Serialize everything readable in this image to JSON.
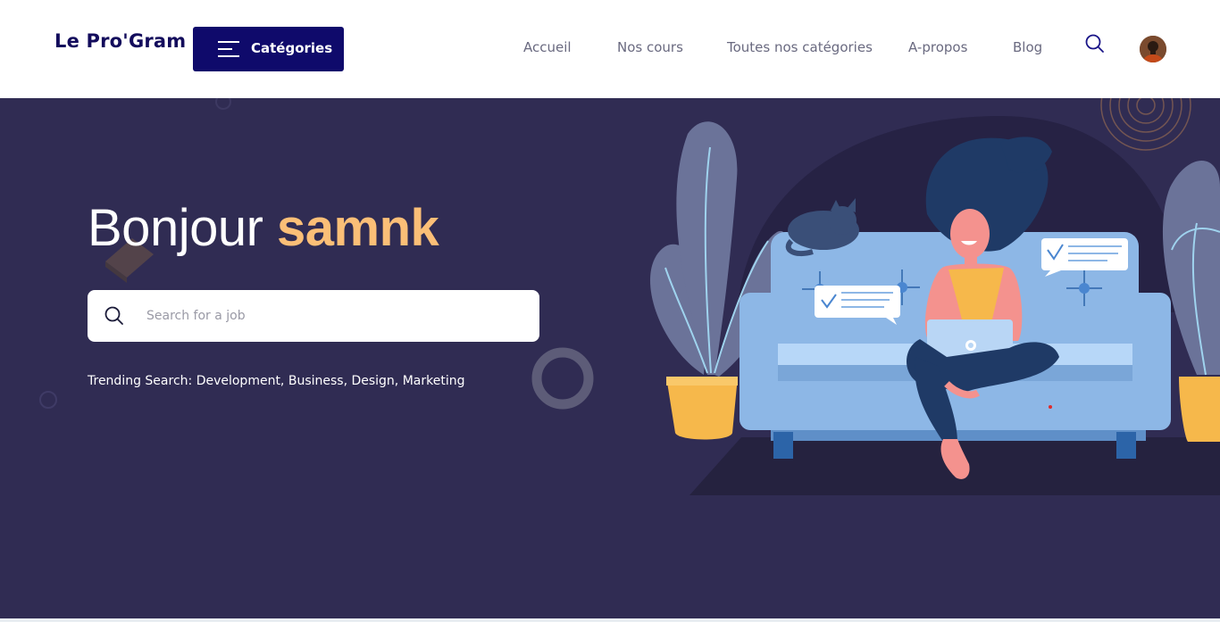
{
  "header": {
    "logo": "Le Pro'Gram",
    "categories_button": "Catégories",
    "nav": [
      "Accueil",
      "Nos cours",
      "Toutes nos catégories",
      "A-propos",
      "Blog"
    ]
  },
  "hero": {
    "greeting": "Bonjour",
    "user_name": "samnk",
    "search_placeholder": "Search for a job",
    "trending_label": "Trending Search:",
    "trending_items": "Development, Business, Design, Marketing"
  },
  "colors": {
    "brand_navy": "#0f0a6b",
    "hero_bg": "#302c53",
    "accent_orange": "#fbbf77",
    "sofa_blue": "#8db7e6"
  },
  "icons": [
    "menu-icon",
    "search-icon",
    "avatar"
  ]
}
